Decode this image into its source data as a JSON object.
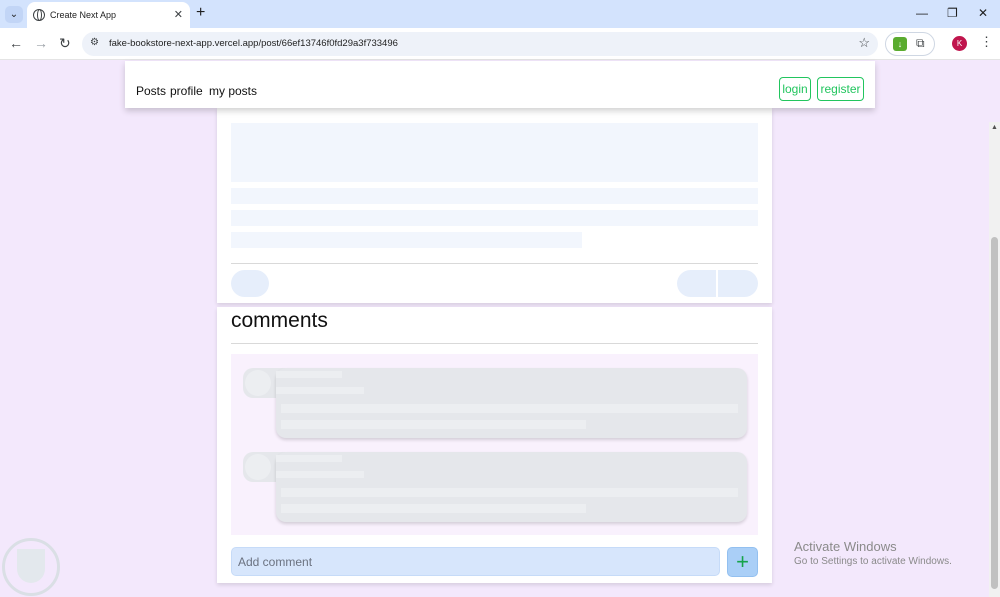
{
  "browser": {
    "tab_title": "Create Next App",
    "tab_close": "✕",
    "new_tab": "+",
    "url": "fake-bookstore-next-app.vercel.app/post/66ef13746f0fd29a3f733496",
    "avatar_letter": "K",
    "icons": [
      "chevron-down-icon",
      "globe-icon",
      "back-arrow-icon",
      "forward-arrow-icon",
      "reload-icon",
      "site-info-icon",
      "star-icon",
      "download-extension-icon",
      "puzzle-icon",
      "more-vert-icon"
    ]
  },
  "navbar": {
    "links": [
      "Posts",
      "profile",
      "my posts"
    ],
    "login": "login",
    "register": "register",
    "accent": "#22c55e"
  },
  "comments": {
    "title": "comments",
    "input_placeholder": "Add comment",
    "add_label": "+"
  },
  "watermark": {
    "line1": "Activate Windows",
    "line2": "Go to Settings to activate Windows."
  }
}
